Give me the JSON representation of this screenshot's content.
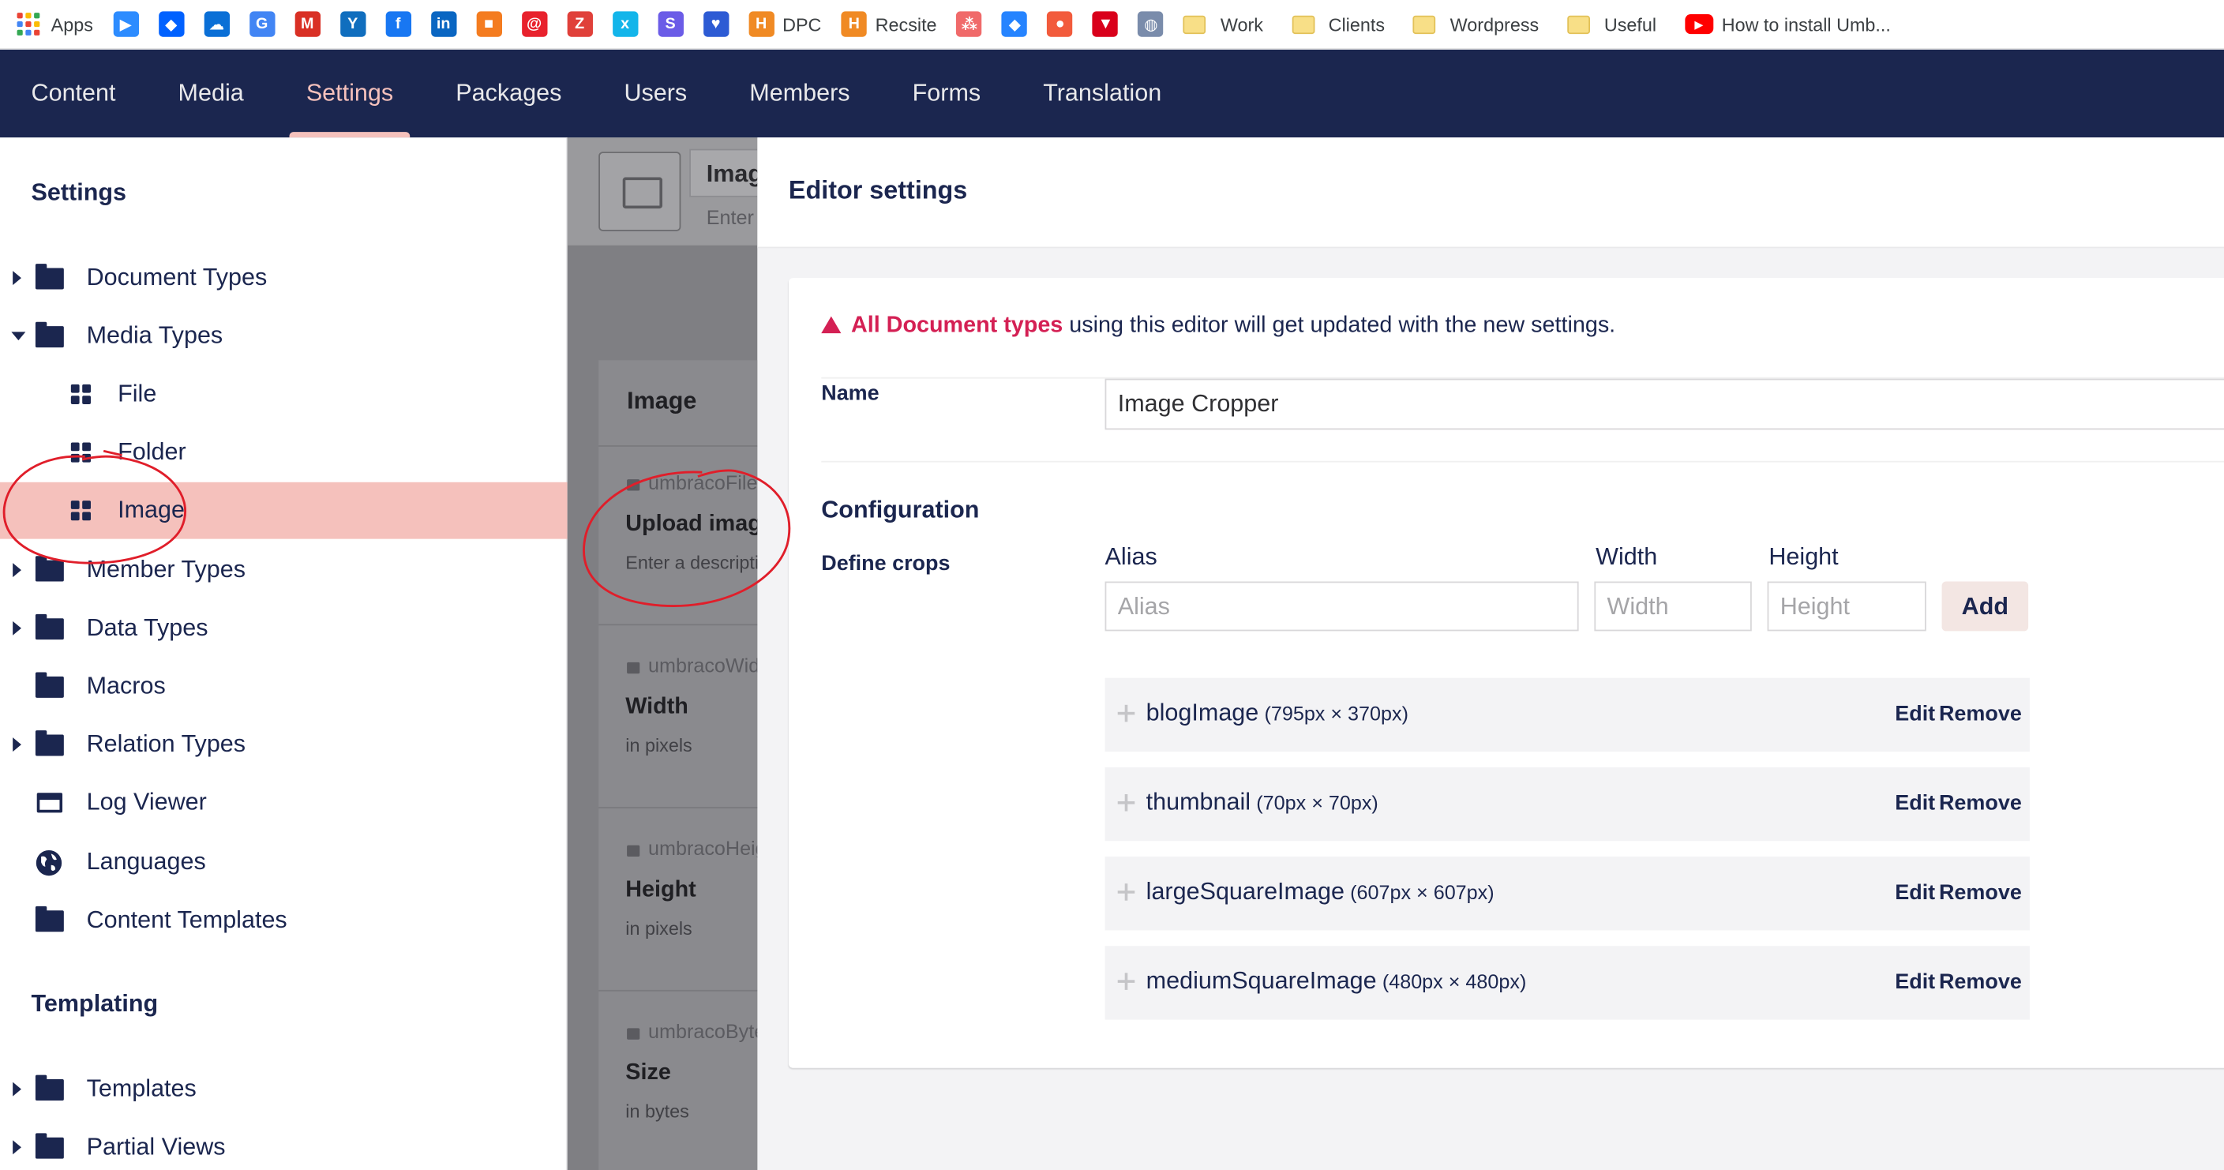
{
  "bookmarks": {
    "apps_label": "Apps",
    "items": [
      {
        "label": "",
        "icon": "zoom-icon",
        "color": "#2d8cff",
        "glyph": "▶"
      },
      {
        "label": "",
        "icon": "dropbox-icon",
        "color": "#0061ff",
        "glyph": "◆"
      },
      {
        "label": "",
        "icon": "onedrive-icon",
        "color": "#0a6fd6",
        "glyph": "☁"
      },
      {
        "label": "",
        "icon": "google-icon",
        "color": "#4285f4",
        "glyph": "G"
      },
      {
        "label": "",
        "icon": "gmail-icon",
        "color": "#d93025",
        "glyph": "M"
      },
      {
        "label": "",
        "icon": "yammer-icon",
        "color": "#106ebe",
        "glyph": "Y"
      },
      {
        "label": "",
        "icon": "facebook-icon",
        "color": "#1877f2",
        "glyph": "f"
      },
      {
        "label": "",
        "icon": "linkedin-icon",
        "color": "#0a66c2",
        "glyph": "in"
      },
      {
        "label": "",
        "icon": "package-icon",
        "color": "#f47c20",
        "glyph": "■"
      },
      {
        "label": "",
        "icon": "at-sign-icon",
        "color": "#e8222d",
        "glyph": "@"
      },
      {
        "label": "",
        "icon": "zotero-icon",
        "color": "#e0403a",
        "glyph": "Z"
      },
      {
        "label": "",
        "icon": "xero-icon",
        "color": "#13b5ea",
        "glyph": "x"
      },
      {
        "label": "",
        "icon": "s-app-icon",
        "color": "#6b5ce7",
        "glyph": "S"
      },
      {
        "label": "",
        "icon": "heart-shield-icon",
        "color": "#2d5bd4",
        "glyph": "♥"
      },
      {
        "label": "DPC",
        "icon": "h-badge-icon",
        "color": "#f08a24",
        "glyph": "H"
      },
      {
        "label": "Recsite",
        "icon": "h-badge-icon",
        "color": "#f08a24",
        "glyph": "H"
      },
      {
        "label": "",
        "icon": "asana-icon",
        "color": "#f06a6a",
        "glyph": "⁂"
      },
      {
        "label": "",
        "icon": "jira-icon",
        "color": "#2684ff",
        "glyph": "◆"
      },
      {
        "label": "",
        "icon": "lock-badge-icon",
        "color": "#f25b3c",
        "glyph": "●"
      },
      {
        "label": "",
        "icon": "shield-icon",
        "color": "#d9001b",
        "glyph": "▼"
      },
      {
        "label": "",
        "icon": "globe-icon",
        "color": "#7a8cab",
        "glyph": "◍"
      }
    ],
    "folders": [
      "Work",
      "Clients",
      "Wordpress",
      "Useful"
    ],
    "video_label": "How to install Umb...",
    "video_icon": "youtube-icon",
    "video_color": "#ff0000"
  },
  "topnav": {
    "items": [
      "Content",
      "Media",
      "Settings",
      "Packages",
      "Users",
      "Members",
      "Forms",
      "Translation"
    ],
    "active": "Settings",
    "accent": "#f5c1bc",
    "background": "#1b264f"
  },
  "tree": {
    "settings_heading": "Settings",
    "items": {
      "document_types": "Document Types",
      "media_types": "Media Types",
      "file": "File",
      "folder": "Folder",
      "image": "Image",
      "member_types": "Member Types",
      "data_types": "Data Types",
      "macros": "Macros",
      "relation_types": "Relation Types",
      "log_viewer": "Log Viewer",
      "languages": "Languages",
      "content_templates": "Content Templates",
      "templates": "Templates",
      "partial_views": "Partial Views"
    },
    "templating_heading": "Templating"
  },
  "middle": {
    "name": "Imag",
    "description_placeholder": "Enter",
    "group_title": "Image",
    "props": [
      {
        "alias": "umbracoFile",
        "label": "Upload image",
        "description": "Enter a description"
      },
      {
        "alias": "umbracoWidth",
        "label": "Width",
        "description": "in pixels"
      },
      {
        "alias": "umbracoHeight",
        "label": "Height",
        "description": "in pixels"
      },
      {
        "alias": "umbracoBytes",
        "label": "Size",
        "description": "in bytes"
      }
    ]
  },
  "editor": {
    "title": "Editor settings",
    "warning_highlight": "All Document types",
    "warning_rest": " using this editor will get updated with the new settings.",
    "name_label": "Name",
    "name_value": "Image Cropper",
    "configuration_heading": "Configuration",
    "define_crops_label": "Define crops",
    "columns": {
      "alias": "Alias",
      "width": "Width",
      "height": "Height"
    },
    "placeholders": {
      "alias": "Alias",
      "width": "Width",
      "height": "Height"
    },
    "add_label": "Add",
    "edit_label": "Edit",
    "remove_label": "Remove",
    "crops": [
      {
        "alias": "blogImage",
        "dims": "(795px × 370px)"
      },
      {
        "alias": "thumbnail",
        "dims": "(70px × 70px)"
      },
      {
        "alias": "largeSquareImage",
        "dims": "(607px × 607px)"
      },
      {
        "alias": "mediumSquareImage",
        "dims": "(480px × 480px)"
      }
    ],
    "warning_color": "#d42054"
  }
}
